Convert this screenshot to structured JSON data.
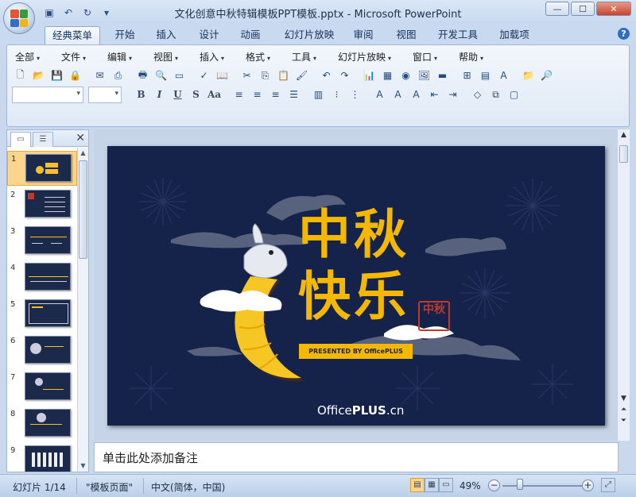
{
  "window": {
    "title": "文化创意中秋特辑模板PPT模板.pptx - Microsoft PowerPoint",
    "controls": [
      "minimize",
      "maximize",
      "close"
    ]
  },
  "quick_access": [
    "save-icon",
    "undo-icon",
    "redo-icon",
    "customize-icon"
  ],
  "ribbon_tabs": [
    {
      "label": "经典菜单",
      "active": true
    },
    {
      "label": "开始"
    },
    {
      "label": "插入"
    },
    {
      "label": "设计"
    },
    {
      "label": "动画"
    },
    {
      "label": "幻灯片放映"
    },
    {
      "label": "审阅"
    },
    {
      "label": "视图"
    },
    {
      "label": "开发工具"
    },
    {
      "label": "加载项"
    }
  ],
  "menus": [
    "全部",
    "文件",
    "编辑",
    "视图",
    "插入",
    "格式",
    "工具",
    "幻灯片放映",
    "窗口",
    "帮助"
  ],
  "format_buttons": [
    "B",
    "I",
    "U",
    "S",
    "Aa"
  ],
  "slides": {
    "count": 14,
    "selected": 1,
    "thumbnails": [
      "1",
      "2",
      "3",
      "4",
      "5",
      "6",
      "7",
      "8",
      "9"
    ]
  },
  "slide": {
    "title_line1": "中秋",
    "title_line2": "快乐",
    "tagline": "PRESENTED BY OfficePLUS",
    "seal_text": "中秋",
    "brand_light": "Office",
    "brand_bold": "PLUS",
    "brand_suffix": ".cn",
    "colors": {
      "background": "#15224a",
      "accent": "#f5b800"
    }
  },
  "notes": {
    "placeholder": "单击此处添加备注"
  },
  "statusbar": {
    "slide_indicator": "幻灯片 1/14",
    "theme": "\"模板页面\"",
    "language": "中文(简体，中国)",
    "zoom": "49%"
  }
}
